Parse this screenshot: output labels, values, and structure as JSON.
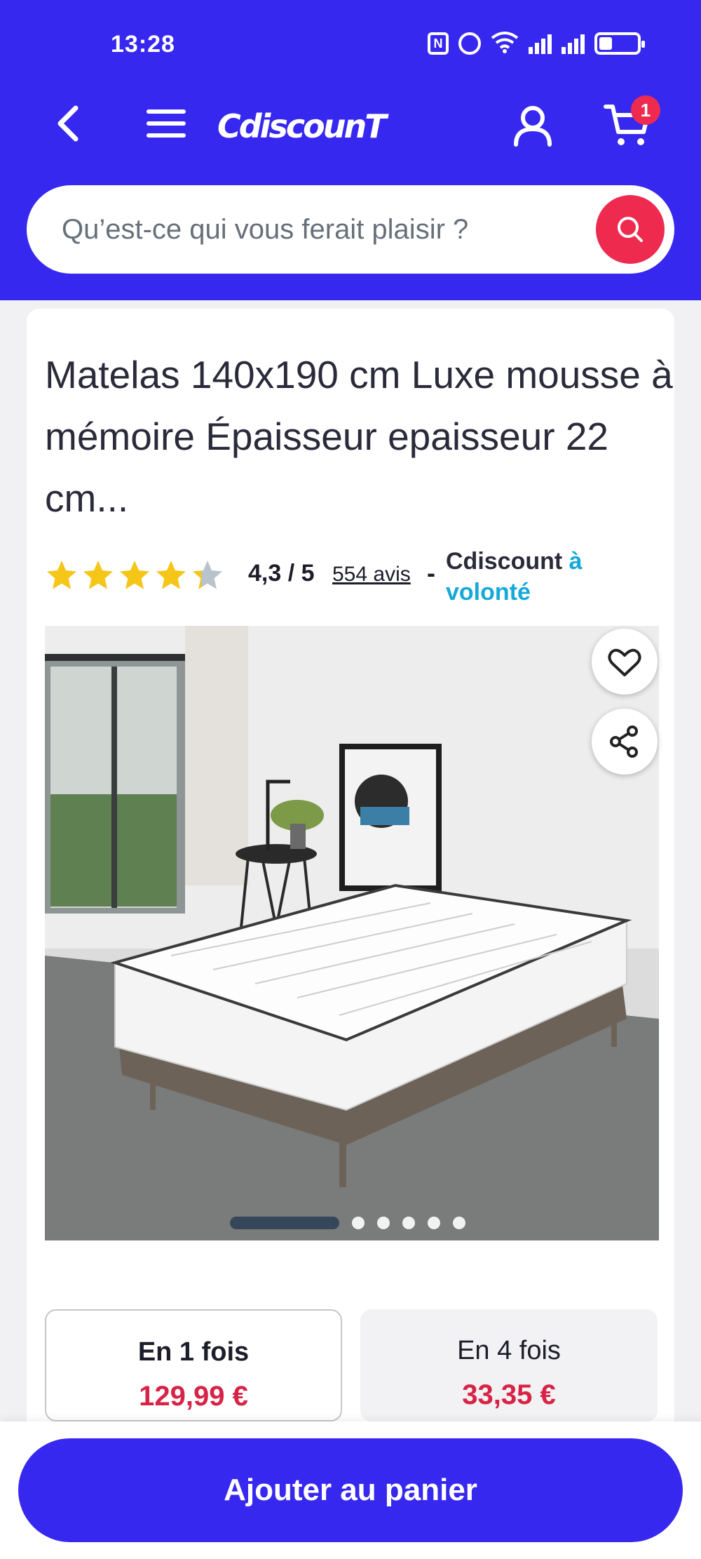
{
  "status_bar": {
    "time": "13:28",
    "nfc_label": "N"
  },
  "header": {
    "logo_text": "CdiscounT",
    "cart_count": "1",
    "brand_color": "#3728f0",
    "accent_color": "#ee2a4f"
  },
  "search": {
    "placeholder": "Qu’est-ce qui vous ferait plaisir ?"
  },
  "product": {
    "title": "Matelas 140x190 cm Luxe mousse à mémoire Épaisseur epaisseur 22 cm...",
    "rating": 4.3,
    "rating_text": "4,3 / 5",
    "reviews_text": "554 avis",
    "separator": "-",
    "seller_name": "Cdiscount",
    "seller_suffix": "à volonté",
    "image_count": 6,
    "active_image_index": 0
  },
  "payment": {
    "options": [
      {
        "label": "En 1 fois",
        "price": "129,99 €",
        "selected": true
      },
      {
        "label": "En 4 fois",
        "price": "33,35 €",
        "selected": false
      }
    ]
  },
  "actions": {
    "add_to_cart_label": "Ajouter au panier"
  }
}
